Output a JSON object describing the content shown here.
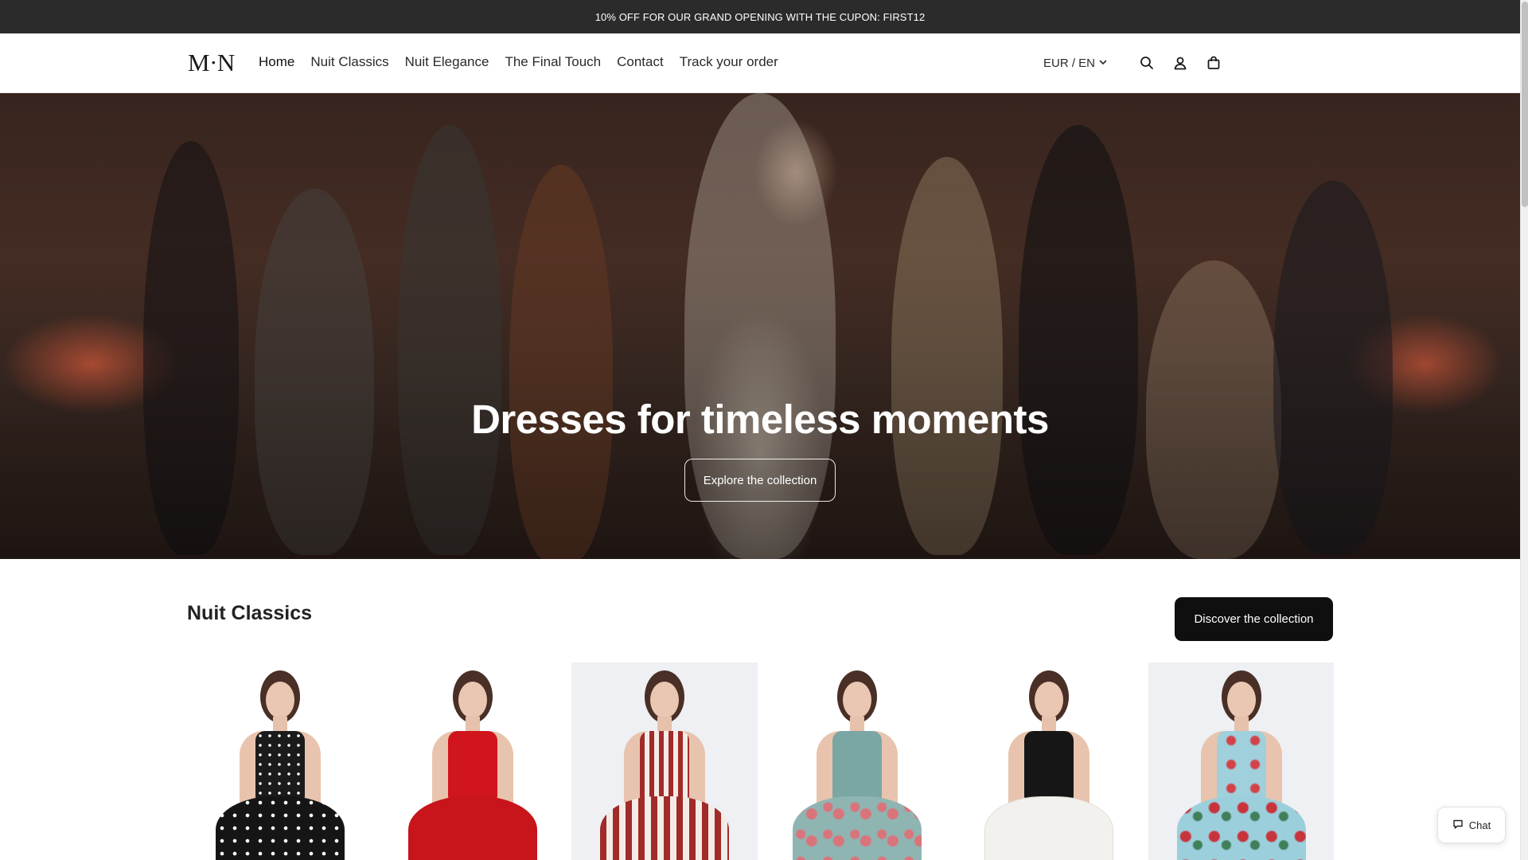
{
  "announcement": {
    "text": "10% OFF FOR OUR GRAND OPENING WITH THE CUPON: FIRST12"
  },
  "header": {
    "logo_text": "M·N",
    "nav": [
      {
        "label": "Home",
        "active": true
      },
      {
        "label": "Nuit Classics"
      },
      {
        "label": "Nuit Elegance"
      },
      {
        "label": "The Final Touch"
      },
      {
        "label": "Contact"
      },
      {
        "label": "Track your order"
      }
    ],
    "currency_label": "EUR / EN",
    "icons": [
      "search-icon",
      "account-icon",
      "cart-icon",
      "chevron-down-icon"
    ]
  },
  "hero": {
    "title": "Dresses for timeless moments",
    "cta_label": "Explore the collection"
  },
  "collection": {
    "title": "Nuit Classics",
    "cta_label": "Discover the collection",
    "products": [
      {
        "dress": "black polka dot",
        "bodice": "#1b1b1b",
        "skirt": "#151515"
      },
      {
        "dress": "red sleeveless",
        "bodice": "#d0151c",
        "skirt": "#c8141b"
      },
      {
        "dress": "red and white striped",
        "bodice": "#b23a3a",
        "skirt": "#c25050"
      },
      {
        "dress": "teal floral",
        "bodice": "#7aa6a4",
        "skirt": "#8fb5b3"
      },
      {
        "dress": "black and white strapless",
        "bodice": "#161616",
        "skirt": "#f3f1ee"
      },
      {
        "dress": "light blue floral",
        "bodice": "#9fd0dc",
        "skirt": "#9ccfdc"
      }
    ]
  },
  "chat": {
    "label": "Chat",
    "icon": "chat-bubble-icon"
  },
  "colors": {
    "announcement_bg": "#2b2b2b",
    "button_bg": "#0f0f0f",
    "text": "#1a1a1a"
  }
}
